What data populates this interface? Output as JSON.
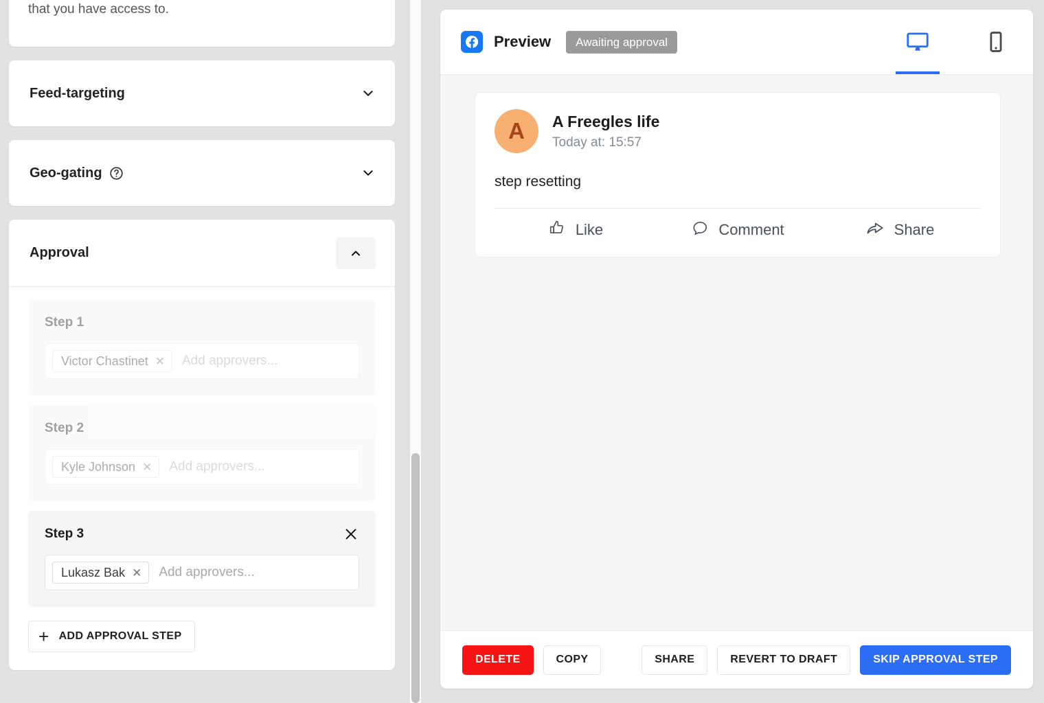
{
  "left_panel": {
    "notice": {
      "text": "The selected channels aren't connected to an ad account that you have access to."
    },
    "accordions": [
      {
        "title": "Feed-targeting",
        "has_help": false,
        "state": "collapsed"
      },
      {
        "title": "Geo-gating",
        "has_help": true,
        "state": "collapsed"
      }
    ],
    "approval": {
      "title": "Approval",
      "state": "expanded",
      "steps": [
        {
          "label": "Step 1",
          "removable": false,
          "disabled": true,
          "approvers": [
            "Victor Chastinet"
          ],
          "placeholder": "Add approvers..."
        },
        {
          "label": "Step 2",
          "removable": false,
          "disabled": true,
          "approvers": [
            "Kyle Johnson"
          ],
          "placeholder": "Add approvers..."
        },
        {
          "label": "Step 3",
          "removable": true,
          "disabled": false,
          "approvers": [
            "Lukasz Bak"
          ],
          "placeholder": "Add approvers..."
        }
      ],
      "add_step_label": "ADD APPROVAL STEP"
    }
  },
  "right_panel": {
    "header": {
      "network": "facebook",
      "preview_label": "Preview",
      "status_badge": "Awaiting approval",
      "devices": [
        {
          "name": "desktop",
          "active": true
        },
        {
          "name": "mobile",
          "active": false
        }
      ]
    },
    "post": {
      "avatar_letter": "A",
      "author": "A Freegles life",
      "timestamp": "Today at: 15:57",
      "message": "step resetting",
      "actions": [
        "Like",
        "Comment",
        "Share"
      ]
    },
    "action_bar": {
      "delete": "DELETE",
      "copy": "COPY",
      "share": "SHARE",
      "revert": "REVERT TO DRAFT",
      "skip": "SKIP APPROVAL STEP"
    }
  },
  "colors": {
    "page_bg": "#e2e2e2",
    "facebook_blue": "#1877f2",
    "accent_blue": "#2b6ef5",
    "danger_red": "#f61414",
    "badge_gray": "#9a9a9a",
    "avatar_bg": "#f8b072"
  }
}
